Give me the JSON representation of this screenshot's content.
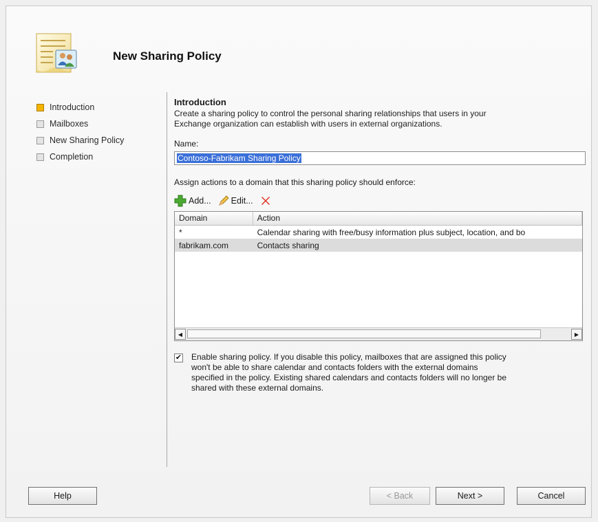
{
  "title": "New Sharing Policy",
  "steps": [
    {
      "label": "Introduction",
      "active": true
    },
    {
      "label": "Mailboxes",
      "active": false
    },
    {
      "label": "New Sharing Policy",
      "active": false
    },
    {
      "label": "Completion",
      "active": false
    }
  ],
  "intro": {
    "heading": "Introduction",
    "description_line1": "Create a sharing policy to control the personal sharing relationships that users in your",
    "description_line2": "Exchange organization can establish with users in external organizations."
  },
  "name": {
    "label": "Name:",
    "value": "Contoso-Fabrikam Sharing Policy"
  },
  "assign_label": "Assign actions to a domain that this sharing policy should enforce:",
  "toolbar": {
    "add": "Add...",
    "edit": "Edit..."
  },
  "grid": {
    "columns": [
      "Domain",
      "Action"
    ],
    "rows": [
      {
        "domain": "*",
        "action": "Calendar sharing with free/busy information plus subject, location, and bo"
      },
      {
        "domain": "fabrikam.com",
        "action": "Contacts sharing"
      }
    ]
  },
  "enable": {
    "checked": true,
    "line1": "Enable sharing policy. If you disable this policy, mailboxes that are assigned this policy",
    "line2": "won't be able to share calendar and contacts folders with the external domains",
    "line3": "specified in the policy. Existing shared calendars and contacts folders will no longer be",
    "line4": "shared with these external domains."
  },
  "buttons": {
    "help": "Help",
    "back": "< Back",
    "next": "Next >",
    "cancel": "Cancel"
  },
  "colors": {
    "active_step": "#f4b400",
    "selection": "#3a6fd8",
    "delete": "#e03020",
    "add": "#4caa32"
  }
}
